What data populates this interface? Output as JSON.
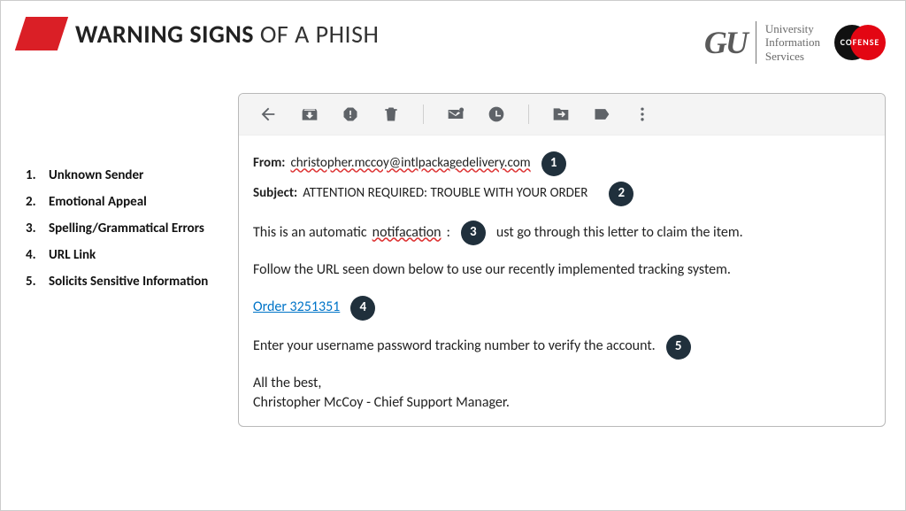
{
  "header": {
    "title_bold": "WARNING SIGNS",
    "title_rest": " OF A PHISH",
    "uis_line1": "University",
    "uis_line2": "Information",
    "uis_line3": "Services",
    "gu": "GU",
    "cofense": "COFENSE"
  },
  "list": {
    "items": [
      "Unknown Sender",
      "Emotional Appeal",
      "Spelling/Grammatical Errors",
      "URL Link",
      "Solicits Sensitive Information"
    ]
  },
  "email": {
    "from_label": "From:",
    "from_addr": "christopher.mccoy@intlpackagedelivery.com",
    "subject_label": "Subject:",
    "subject": "ATTENTION REQUIRED: TROUBLE WITH YOUR ORDER",
    "body1_pre": "This is an automatic ",
    "body1_err": "notifacation",
    "body1_mid": ": ",
    "body1_post": " ust go through this letter to claim the item.",
    "body2": "Follow the URL seen down below to use our recently implemented tracking system.",
    "link": "Order 3251351",
    "body3": "Enter your username password tracking number to verify the account.",
    "close1": "All the best,",
    "close2": "Christopher McCoy - Chief Support Manager."
  },
  "badges": {
    "b1": "1",
    "b2": "2",
    "b3": "3",
    "b4": "4",
    "b5": "5"
  },
  "icons": {
    "back": "back-icon",
    "archive": "archive-icon",
    "report": "report-spam-icon",
    "delete": "delete-icon",
    "unread": "mark-unread-icon",
    "snooze": "snooze-icon",
    "move": "move-to-icon",
    "label": "label-icon",
    "more": "more-icon"
  }
}
